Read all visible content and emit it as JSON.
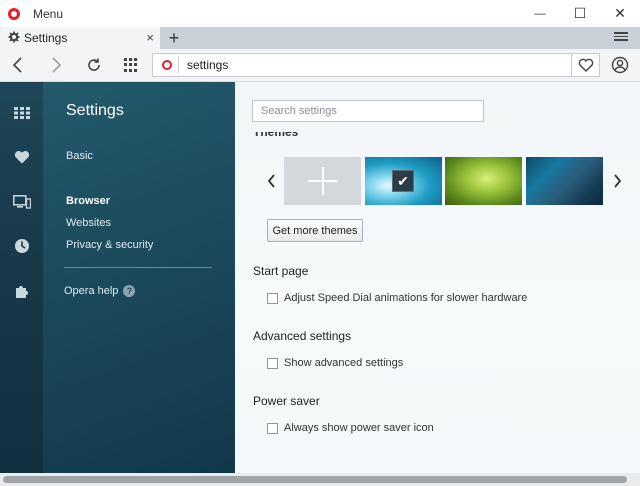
{
  "window": {
    "menu_label": "Menu",
    "minimize_glyph": "—",
    "maximize_glyph": "☐",
    "close_glyph": "✕"
  },
  "tab": {
    "title": "Settings",
    "close_glyph": "×",
    "new_tab_glyph": "+"
  },
  "toolbar": {
    "back_glyph": "‹",
    "forward_glyph": "›",
    "reload_glyph": "↻",
    "url": "settings"
  },
  "sidebar_icons": [
    "speed-dial-icon",
    "heart-icon",
    "devices-icon",
    "history-icon",
    "extensions-icon"
  ],
  "nav": {
    "title": "Settings",
    "basic": "Basic",
    "browser": "Browser",
    "websites": "Websites",
    "privacy": "Privacy & security",
    "help": "Opera help",
    "help_glyph": "?"
  },
  "main": {
    "search_placeholder": "Search settings",
    "themes_heading": "Themes",
    "arrow_left": "‹",
    "arrow_right": "›",
    "check_glyph": "✔",
    "get_more_themes": "Get more themes",
    "start_page": {
      "heading": "Start page",
      "option": "Adjust Speed Dial animations for slower hardware"
    },
    "advanced": {
      "heading": "Advanced settings",
      "option": "Show advanced settings"
    },
    "power_saver": {
      "heading": "Power saver",
      "option": "Always show power saver icon"
    }
  },
  "colors": {
    "sidebar": "#173646",
    "settings_nav": "#1c4c5e",
    "opera_red": "#e0202a",
    "tabbar": "#c9d0d8"
  }
}
